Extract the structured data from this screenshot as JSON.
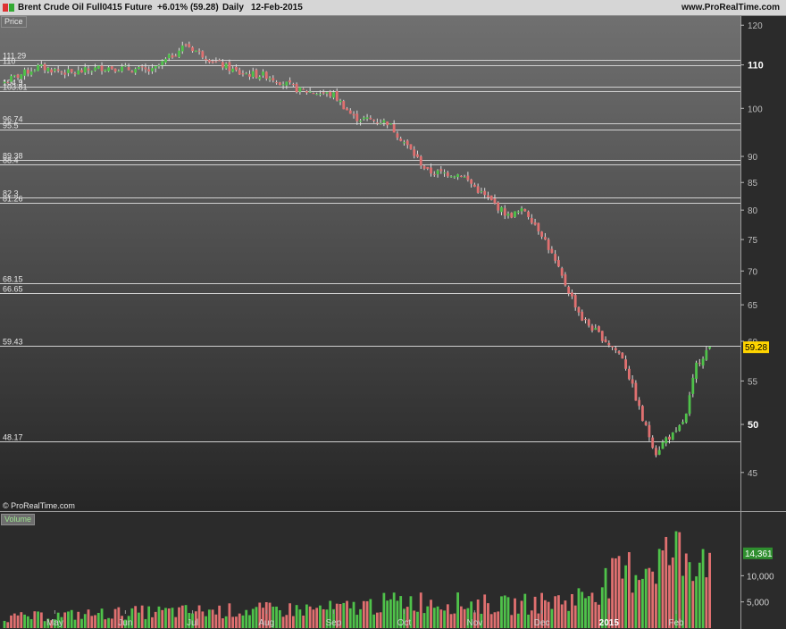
{
  "header": {
    "instrument": "Brent Crude Oil Full0415 Future",
    "change": "+6.01% (59.28)",
    "period": "Daily",
    "date": "12-Feb-2015",
    "site": "www.ProRealTime.com"
  },
  "panels": {
    "price_label": "Price",
    "volume_label": "Volume"
  },
  "copyright": "© ProRealTime.com",
  "colors": {
    "up": "#4fc24a",
    "down": "#e07070",
    "price_tag": "#ffd400",
    "volume_tag": "#2f8f2f"
  },
  "chart_data": {
    "type": "candlestick",
    "yscale": "log",
    "ylim": [
      43,
      121
    ],
    "price_ticks": [
      120,
      110,
      100,
      90,
      85,
      80,
      75,
      70,
      65,
      60,
      55,
      50,
      45
    ],
    "price_major_ticks": [
      110,
      50
    ],
    "levels": [
      {
        "value": 111.29,
        "label": "111.29"
      },
      {
        "value": 110.0,
        "label": "110"
      },
      {
        "value": 104.9,
        "label": "104.9"
      },
      {
        "value": 103.81,
        "label": "103.81"
      },
      {
        "value": 96.74,
        "label": "96.74"
      },
      {
        "value": 95.5,
        "label": "95.5"
      },
      {
        "value": 89.38,
        "label": "89.38"
      },
      {
        "value": 88.4,
        "label": "88.4"
      },
      {
        "value": 82.3,
        "label": "82.3"
      },
      {
        "value": 81.26,
        "label": "81.26"
      },
      {
        "value": 68.15,
        "label": "68.15"
      },
      {
        "value": 66.65,
        "label": "66.65"
      },
      {
        "value": 59.43,
        "label": "59.43"
      },
      {
        "value": 48.17,
        "label": "48.17"
      }
    ],
    "last_price": {
      "value": 59.28,
      "label": "59.28"
    },
    "months": [
      "May",
      "Jun",
      "Jul",
      "Aug",
      "Sep",
      "Oct",
      "Nov",
      "Dec",
      "2015",
      "Feb"
    ],
    "month_start_index": [
      15,
      36,
      56,
      78,
      98,
      119,
      140,
      160,
      180,
      200
    ],
    "anchors": [
      [
        0,
        106
      ],
      [
        10,
        109.5
      ],
      [
        20,
        108
      ],
      [
        30,
        109.5
      ],
      [
        44,
        108.5
      ],
      [
        54,
        115
      ],
      [
        62,
        111
      ],
      [
        70,
        108
      ],
      [
        78,
        107.5
      ],
      [
        88,
        104
      ],
      [
        98,
        103
      ],
      [
        104,
        98
      ],
      [
        114,
        97
      ],
      [
        120,
        92
      ],
      [
        126,
        87
      ],
      [
        136,
        86.5
      ],
      [
        142,
        83
      ],
      [
        150,
        79
      ],
      [
        155,
        80
      ],
      [
        160,
        76
      ],
      [
        166,
        69
      ],
      [
        172,
        63
      ],
      [
        178,
        60.5
      ],
      [
        184,
        58
      ],
      [
        190,
        50.5
      ],
      [
        194,
        47
      ],
      [
        197,
        48.5
      ],
      [
        200,
        49
      ],
      [
        203,
        51
      ],
      [
        206,
        57
      ],
      [
        210,
        59.28
      ]
    ],
    "volume": {
      "ylim": [
        0,
        22000
      ],
      "ticks": [
        5000,
        10000
      ],
      "tick_labels": [
        "5,000",
        "10,000"
      ],
      "last_value": 14361,
      "last_label": "14,361",
      "segments": [
        [
          0,
          2000
        ],
        [
          40,
          3000
        ],
        [
          100,
          3700
        ],
        [
          120,
          5200
        ],
        [
          150,
          4300
        ],
        [
          170,
          5500
        ],
        [
          180,
          9000
        ],
        [
          190,
          12000
        ],
        [
          200,
          14361
        ],
        [
          210,
          14361
        ]
      ]
    }
  }
}
